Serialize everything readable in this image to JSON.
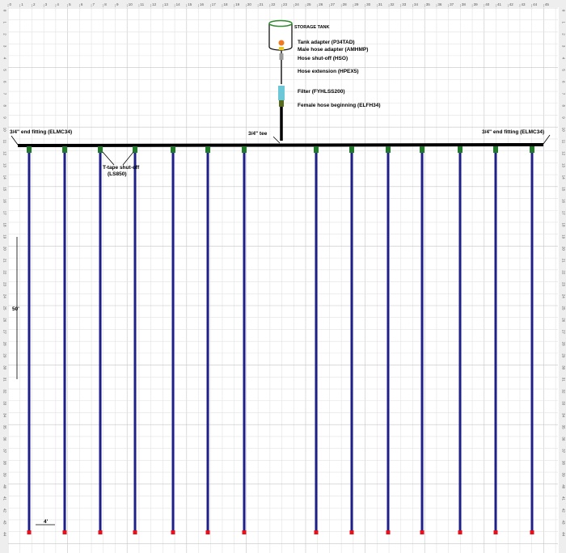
{
  "tank": {
    "label": "STORAGE TANK"
  },
  "components": [
    {
      "key": "tank-adapter",
      "label": "Tank adapter (P34TAD)",
      "color": "#f07a20",
      "icon": "circle"
    },
    {
      "key": "male-hose-adapter",
      "label": "Male hose adapter (AMHMP)",
      "color": "#e8c81e",
      "icon": "small-rect"
    },
    {
      "key": "hose-shutoff",
      "label": "Hose shut-off (HSO)",
      "color": "#9a9a9a",
      "icon": "small-rect"
    },
    {
      "key": "hose-extension",
      "label": "Hose extension (HPEX5)",
      "color": "#555555",
      "icon": "line"
    },
    {
      "key": "filter",
      "label": "Filter (FYHLSS200)",
      "color": "#6cc7d6",
      "icon": "rect"
    },
    {
      "key": "female-hose-beginning",
      "label": "Female hose beginning (ELFH34)",
      "color": "#556b1e",
      "icon": "small-rect"
    }
  ],
  "labels": {
    "tee": "3/4\" tee",
    "end_fitting_left": "3/4\" end fitting (ELMC34)",
    "end_fitting_right": "3/4\" end fitting (ELMC34)",
    "tshutoff_line1": "T-tape shut-off",
    "tshutoff_line2": "(LS850)",
    "length_dim": "50'",
    "spacing_dim": "4'"
  },
  "ruler": {
    "top": [
      "0",
      "1",
      "2",
      "3",
      "4",
      "5",
      "6",
      "7",
      "8",
      "9",
      "10",
      "11",
      "12",
      "13",
      "14",
      "15",
      "16",
      "17",
      "18",
      "19",
      "20",
      "21",
      "22",
      "23",
      "24",
      "25",
      "26",
      "27",
      "28",
      "29",
      "30",
      "31",
      "32",
      "33",
      "34",
      "35",
      "36",
      "37",
      "38",
      "39",
      "40",
      "41",
      "42",
      "43",
      "44",
      "45"
    ],
    "side": [
      "0",
      "1",
      "2",
      "3",
      "4",
      "5",
      "6",
      "7",
      "8",
      "9",
      "10",
      "11",
      "12",
      "13",
      "14",
      "15",
      "16",
      "17",
      "18",
      "19",
      "20",
      "21",
      "22",
      "23",
      "24",
      "25",
      "26",
      "27",
      "28",
      "29",
      "30",
      "31",
      "32",
      "33",
      "34",
      "35",
      "36",
      "37",
      "38",
      "39",
      "40",
      "41",
      "42",
      "43",
      "44"
    ]
  },
  "colors": {
    "header_pipe": "#000000",
    "drip_line": "#1f1f8c",
    "shutoff": "#1f7a2a",
    "end_cap": "#e8101a"
  },
  "drip_line_count": 14
}
